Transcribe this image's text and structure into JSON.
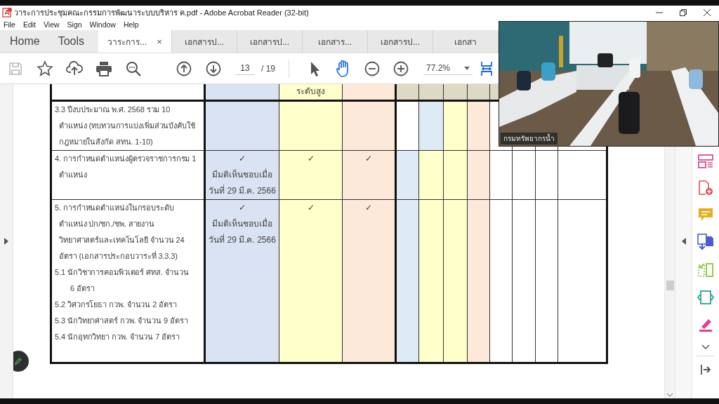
{
  "window": {
    "title": "วาระการประชุมคณะกรรมการพัฒนาระบบบริหาร ค.pdf - Adobe Acrobat Reader (32-bit)"
  },
  "menu": [
    "File",
    "Edit",
    "View",
    "Sign",
    "Window",
    "Help"
  ],
  "nav": [
    "Home",
    "Tools"
  ],
  "tabs": [
    {
      "label": "วาระการ...",
      "selected": true,
      "close": "×"
    },
    {
      "label": "เอกสารป...",
      "selected": false
    },
    {
      "label": "เอกสารป...",
      "selected": false
    },
    {
      "label": "เอกสาร...",
      "selected": false
    },
    {
      "label": "เอกสารป...",
      "selected": false
    },
    {
      "label": "เอกสา",
      "selected": false
    }
  ],
  "toolbar": {
    "page": "13",
    "page_total": "/ 19",
    "zoom": "77.2%",
    "tools": [
      {
        "kind": "select",
        "selected": false
      },
      {
        "kind": "hand",
        "selected": true
      }
    ]
  },
  "table": {
    "header": {
      "cells": [
        {
          "color": "#ffffff"
        },
        {
          "color": "#dae3f3"
        },
        {
          "color": "#ffffcc",
          "lines": [
            "ระดับสูง"
          ]
        },
        {
          "color": "#fde9d9"
        },
        {
          "color": "#ddd9c4"
        },
        {
          "color": "#ddd9c4"
        },
        {
          "color": "#ddd9c4"
        },
        {
          "color": "#ddd9c4"
        },
        {
          "color": "#ddd9c4"
        }
      ]
    },
    "rows": [
      {
        "cells": [
          {
            "color": "#ffffff",
            "paragraphs": [
              {
                "lines": [
                  "3.3 ปีงบประมาณ พ.ศ. 2568 รวม 10",
                  "ตำแหน่ง (ทบทวนการแบ่งเพิ่มส่วนบังคับใช้",
                  "กฎหมายในสังกัด สทน. 1-10)"
                ]
              }
            ]
          },
          {
            "color": "#dae3f3"
          },
          {
            "color": "#ffffcc"
          },
          {
            "color": "#fde9d9"
          },
          {
            "color": "#ffffff"
          },
          {
            "color": "#deebf7"
          },
          {
            "color": "#ffffcc"
          },
          {
            "color": "#fde9d9"
          },
          {
            "color": "#ffffff"
          },
          {
            "color": "#ffffff"
          },
          {
            "color": "#ffffff"
          },
          {
            "color": "#ffffff"
          }
        ]
      },
      {
        "cells": [
          {
            "color": "#ffffff",
            "paragraphs": [
              {
                "lines": [
                  "4. การกำหนดตำแหน่งผู้ตรวจราชการกรม 1",
                  "ตำแหน่ง"
                ]
              }
            ]
          },
          {
            "color": "#dae3f3",
            "lines": [
              "✓",
              "มีมติเห็นชอบเมื่อ",
              "วันที่ 29  มี.ค. 2566"
            ]
          },
          {
            "color": "#ffffcc",
            "lines": [
              "✓"
            ]
          },
          {
            "color": "#fde9d9",
            "lines": [
              "✓"
            ]
          },
          {
            "color": "#deebf7"
          },
          {
            "color": "#ffffcc"
          },
          {
            "color": "#ffffcc"
          },
          {
            "color": "#fde9d9"
          },
          {
            "color": "#ffffff"
          },
          {
            "color": "#ffffff"
          },
          {
            "color": "#ffffff"
          },
          {
            "color": "#ffffff"
          }
        ]
      },
      {
        "cells": [
          {
            "color": "#ffffff",
            "paragraphs": [
              {
                "lines": [
                  "5. การกำหนดตำแหน่งในกรอบระดับ",
                  "ตำแหน่ง ปก/ชก./ชพ. สายงาน",
                  "วิทยาศาสตร์และเทคโนโลยี จำนวน 24",
                  "อัตรา  (เอกสารประกอบวาระที่ 3.3.3)"
                ],
                "children": [
                  {
                    "lines": [
                      "5.1 นักวิชาการคอมพิวเตอร์ ศทส. จำนวน",
                      "6 อัตรา"
                    ]
                  },
                  {
                    "lines": [
                      "5.2 วิศวกรโยธา กวพ. จำนวน 2 อัตรา"
                    ]
                  },
                  {
                    "lines": [
                      "5.3 นักวิทยาศาสตร์ กวพ. จำนวน 9 อัตรา"
                    ]
                  },
                  {
                    "lines": [
                      "5.4 นักอุทกวิทยา กวพ. จำนวน 7 อัตรา"
                    ]
                  }
                ]
              }
            ]
          },
          {
            "color": "#dae3f3",
            "lines": [
              "✓",
              "มีมติเห็นชอบเมื่อ",
              "วันที่ 29  มี.ค. 2566"
            ]
          },
          {
            "color": "#ffffcc",
            "lines": [
              "✓"
            ]
          },
          {
            "color": "#fde9d9",
            "lines": [
              "✓"
            ]
          },
          {
            "color": "#deebf7"
          },
          {
            "color": "#ffffcc"
          },
          {
            "color": "#ffffcc"
          },
          {
            "color": "#fde9d9"
          },
          {
            "color": "#ffffff"
          },
          {
            "color": "#ffffff"
          },
          {
            "color": "#ffffff"
          },
          {
            "color": "#ffffff"
          }
        ]
      }
    ]
  },
  "video": {
    "caption": "กรมทรัพยากรน้ำ"
  }
}
